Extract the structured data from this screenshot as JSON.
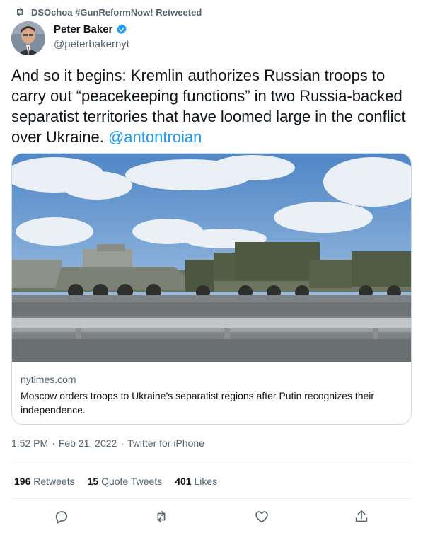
{
  "retweet_banner": {
    "text": "DSOchoa #GunReformNow! Retweeted"
  },
  "author": {
    "name": "Peter Baker",
    "handle": "@peterbakernyt"
  },
  "tweet": {
    "text": "And so it begins: Kremlin authorizes Russian troops to carry out “peacekeeping functions” in two Russia-backed separatist territories that have loomed large in the conflict over Ukraine.",
    "mention": "@antontroian"
  },
  "card": {
    "domain": "nytimes.com",
    "headline": "Moscow orders troops to Ukraine’s separatist regions after Putin recognizes their independence."
  },
  "meta": {
    "time": "1:52 PM",
    "date": "Feb 21, 2022",
    "source": "Twitter for iPhone",
    "sep": "·"
  },
  "stats": {
    "retweets_count": "196",
    "retweets_label": "Retweets",
    "quotes_count": "15",
    "quotes_label": "Quote Tweets",
    "likes_count": "401",
    "likes_label": "Likes"
  },
  "icons": {
    "retweet": "retweet-icon",
    "verified": "verified-badge-icon",
    "reply": "reply-icon",
    "like": "heart-icon",
    "share": "share-icon"
  },
  "colors": {
    "accent": "#1d9bf0",
    "muted": "#536471",
    "text": "#0f1419",
    "border": "#cfd9de"
  }
}
